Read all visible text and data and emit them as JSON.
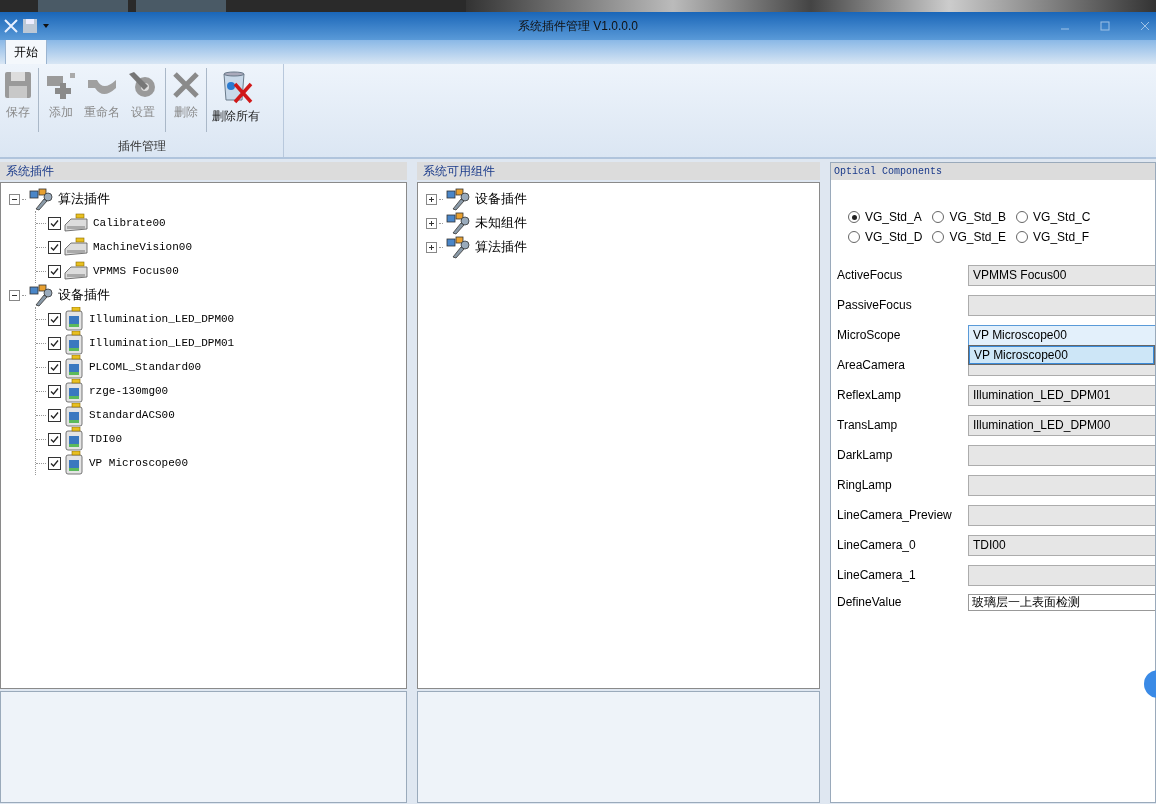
{
  "window": {
    "title": "系统插件管理 V1.0.0.0"
  },
  "ribbon": {
    "tabs": [
      {
        "label": "开始",
        "selected": true
      }
    ],
    "buttons": [
      {
        "label": "保存",
        "kind": "save",
        "disabled": true
      },
      {
        "label": "添加",
        "kind": "add",
        "disabled": true
      },
      {
        "label": "重命名",
        "kind": "rename",
        "disabled": true
      },
      {
        "label": "设置",
        "kind": "settings",
        "disabled": true
      },
      {
        "label": "删除",
        "kind": "delete",
        "disabled": true
      },
      {
        "label": "删除所有",
        "kind": "delete_all",
        "disabled": false
      }
    ],
    "group_label": "插件管理"
  },
  "system_plugins": {
    "title": "系统插件",
    "tree": [
      {
        "label": "算法插件",
        "expanded": true,
        "children": [
          {
            "label": "Calibrate00",
            "kind": "algorithm",
            "checked": true
          },
          {
            "label": "MachineVision00",
            "kind": "algorithm",
            "checked": true
          },
          {
            "label": "VPMMS Focus00",
            "kind": "algorithm",
            "checked": true
          }
        ]
      },
      {
        "label": "设备插件",
        "expanded": true,
        "children": [
          {
            "label": "Illumination_LED_DPM00",
            "kind": "device",
            "checked": true
          },
          {
            "label": "Illumination_LED_DPM01",
            "kind": "device",
            "checked": true
          },
          {
            "label": "PLCOML_Standard00",
            "kind": "device",
            "checked": true
          },
          {
            "label": "rzge-130mg00",
            "kind": "device",
            "checked": true
          },
          {
            "label": "StandardACS00",
            "kind": "device",
            "checked": true
          },
          {
            "label": "TDI00",
            "kind": "device",
            "checked": true
          },
          {
            "label": "VP Microscope00",
            "kind": "device",
            "checked": true
          }
        ]
      }
    ]
  },
  "available_components": {
    "title": "系统可用组件",
    "tree": [
      {
        "label": "设备插件",
        "expanded": false
      },
      {
        "label": "未知组件",
        "expanded": false
      },
      {
        "label": "算法插件",
        "expanded": false
      }
    ]
  },
  "optical_components": {
    "title": "Optical Components",
    "radios": [
      {
        "label": "VG_Std_A",
        "selected": true
      },
      {
        "label": "VG_Std_B",
        "selected": false
      },
      {
        "label": "VG_Std_C",
        "selected": false
      },
      {
        "label": "VG_Std_D",
        "selected": false
      },
      {
        "label": "VG_Std_E",
        "selected": false
      },
      {
        "label": "VG_Std_F",
        "selected": false
      }
    ],
    "fields": [
      {
        "label": "ActiveFocus",
        "kind": "combo",
        "value": "VPMMS Focus00"
      },
      {
        "label": "PassiveFocus",
        "kind": "combo"
      },
      {
        "label": "MicroScope",
        "kind": "combo",
        "value": "VP Microscope00",
        "expanded": true,
        "options": [
          {
            "label": "VP Microscope00",
            "selected": true
          }
        ]
      },
      {
        "label": "AreaCamera",
        "kind": "combo"
      },
      {
        "label": "ReflexLamp",
        "kind": "combo",
        "value": "Illumination_LED_DPM01"
      },
      {
        "label": "TransLamp",
        "kind": "combo",
        "value": "Illumination_LED_DPM00"
      },
      {
        "label": "DarkLamp",
        "kind": "combo"
      },
      {
        "label": "RingLamp",
        "kind": "combo"
      },
      {
        "label": "LineCamera_Preview",
        "kind": "combo"
      },
      {
        "label": "LineCamera_0",
        "kind": "combo",
        "value": "TDI00"
      },
      {
        "label": "LineCamera_1",
        "kind": "combo"
      },
      {
        "label": "DefineValue",
        "kind": "text",
        "value": "玻璃层一上表面检测"
      }
    ]
  }
}
